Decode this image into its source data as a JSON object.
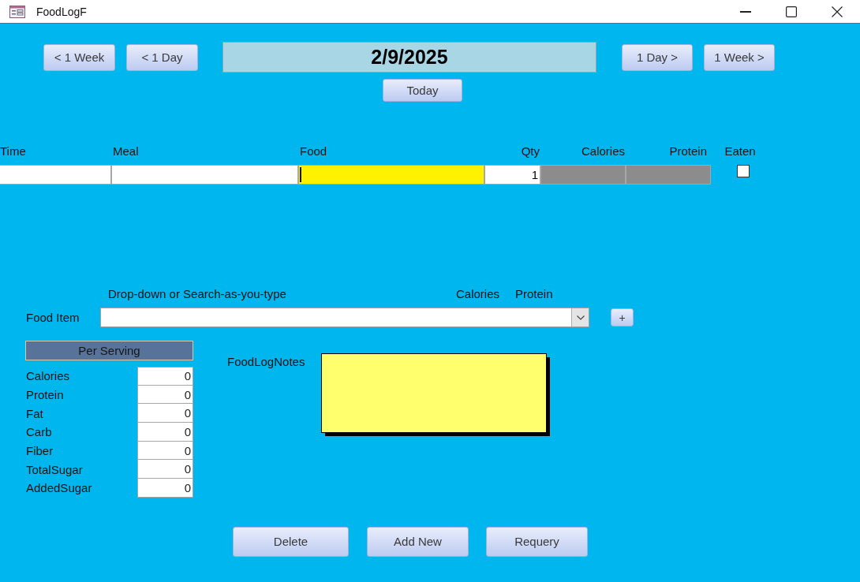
{
  "window": {
    "title": "FoodLogF"
  },
  "date_nav": {
    "back_buttons": [
      "< 1 Week",
      "< 1 Day"
    ],
    "date": "2/9/2025",
    "forward_buttons": [
      "1 Day >",
      "1 Week >"
    ],
    "today_button": "Today"
  },
  "log_table": {
    "columns": [
      {
        "label": "Time",
        "kind": "text"
      },
      {
        "label": "Meal",
        "kind": "text"
      },
      {
        "label": "Food",
        "kind": "text"
      },
      {
        "label": "Qty",
        "kind": "number"
      },
      {
        "label": "Calories",
        "kind": "computed"
      },
      {
        "label": "Protein",
        "kind": "computed"
      },
      {
        "label": "Eaten",
        "kind": "checkbox"
      }
    ],
    "rows": [
      {
        "cells": [
          {
            "focused": false
          },
          {
            "focused": false
          },
          {
            "focused": true
          },
          {
            "value": "1",
            "focused": false
          },
          {
            "focused": false
          },
          {
            "focused": false
          },
          {
            "checked": false
          }
        ]
      }
    ]
  },
  "food_lookup": {
    "hint": "Drop-down or Search-as-you-type",
    "column_labels": [
      "Calories",
      "Protein"
    ],
    "label": "Food Item",
    "add_button": "+"
  },
  "per_serving": {
    "title": "Per Serving",
    "rows": [
      {
        "label": "Calories",
        "value": "0"
      },
      {
        "label": "Protein",
        "value": "0"
      },
      {
        "label": "Fat",
        "value": "0"
      },
      {
        "label": "Carb",
        "value": "0"
      },
      {
        "label": "Fiber",
        "value": "0"
      },
      {
        "label": "TotalSugar",
        "value": "0"
      },
      {
        "label": "AddedSugar",
        "value": "0"
      }
    ]
  },
  "notes": {
    "label": "FoodLogNotes"
  },
  "actions": [
    "Delete",
    "Add New",
    "Requery"
  ]
}
